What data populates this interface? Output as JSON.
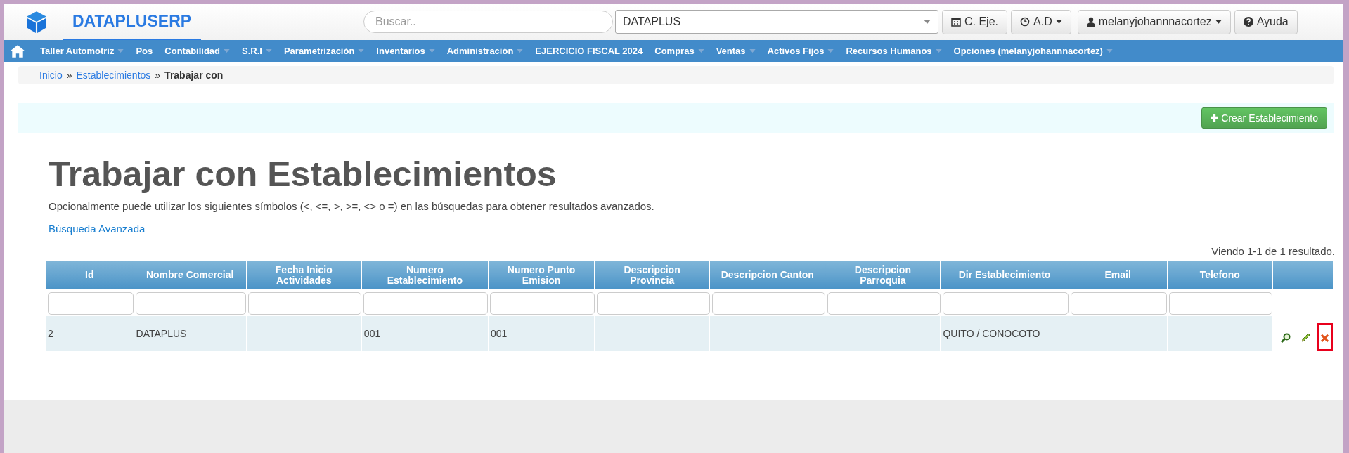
{
  "header": {
    "brand": "DATAPLUSERP",
    "search": {
      "placeholder": "Buscar.."
    },
    "company_select": {
      "value": "DATAPLUS"
    },
    "buttons": [
      {
        "kind": "calendar",
        "label": "C. Eje.",
        "dropdown": false
      },
      {
        "kind": "clock",
        "label": "A.D",
        "dropdown": true
      },
      {
        "kind": "user",
        "label": "melanyjohannnacortez",
        "dropdown": true
      },
      {
        "kind": "help",
        "label": "Ayuda",
        "dropdown": false
      }
    ]
  },
  "nav": [
    {
      "label": "Taller Automotriz",
      "dropdown": true
    },
    {
      "label": "Pos",
      "dropdown": false
    },
    {
      "label": "Contabilidad",
      "dropdown": true
    },
    {
      "label": "S.R.I",
      "dropdown": true
    },
    {
      "label": "Parametrización",
      "dropdown": true
    },
    {
      "label": "Inventarios",
      "dropdown": true
    },
    {
      "label": "Administración",
      "dropdown": true
    },
    {
      "label": "EJERCICIO FISCAL 2024",
      "dropdown": false
    },
    {
      "label": "Compras",
      "dropdown": true
    },
    {
      "label": "Ventas",
      "dropdown": true
    },
    {
      "label": "Activos Fijos",
      "dropdown": true
    },
    {
      "label": "Recursos Humanos",
      "dropdown": true
    },
    {
      "label": "Opciones (melanyjohannnacortez)",
      "dropdown": true
    }
  ],
  "breadcrumb": [
    {
      "label": "Inicio",
      "link": true
    },
    {
      "label": "Establecimientos",
      "link": true
    },
    {
      "label": "Trabajar con",
      "link": false
    }
  ],
  "breadcrumb_separator": "»",
  "create_button": "Crear Establecimiento",
  "title": "Trabajar con Establecimientos",
  "description": "Opcionalmente puede utilizar los siguientes símbolos (<, <=, >, >=, <> o =) en las búsquedas para obtener resultados avanzados.",
  "advanced_search": "Búsqueda Avanzada",
  "summary": "Viendo 1-1 de 1 resultado.",
  "table": {
    "columns": [
      "Id",
      "Nombre Comercial",
      "Fecha Inicio Actividades",
      "Numero Establecimiento",
      "Numero Punto Emision",
      "Descripcion Provincia",
      "Descripcion Canton",
      "Descripcion Parroquia",
      "Dir Establecimiento",
      "Email",
      "Telefono"
    ],
    "rows": [
      {
        "cells": [
          "2",
          "DATAPLUS",
          "",
          "001",
          "001",
          "",
          "",
          "",
          "QUITO / CONOCOTO",
          "",
          ""
        ],
        "actions": [
          {
            "kind": "view",
            "highlighted": false
          },
          {
            "kind": "edit",
            "highlighted": false
          },
          {
            "kind": "delete",
            "highlighted": true
          }
        ]
      }
    ]
  }
}
